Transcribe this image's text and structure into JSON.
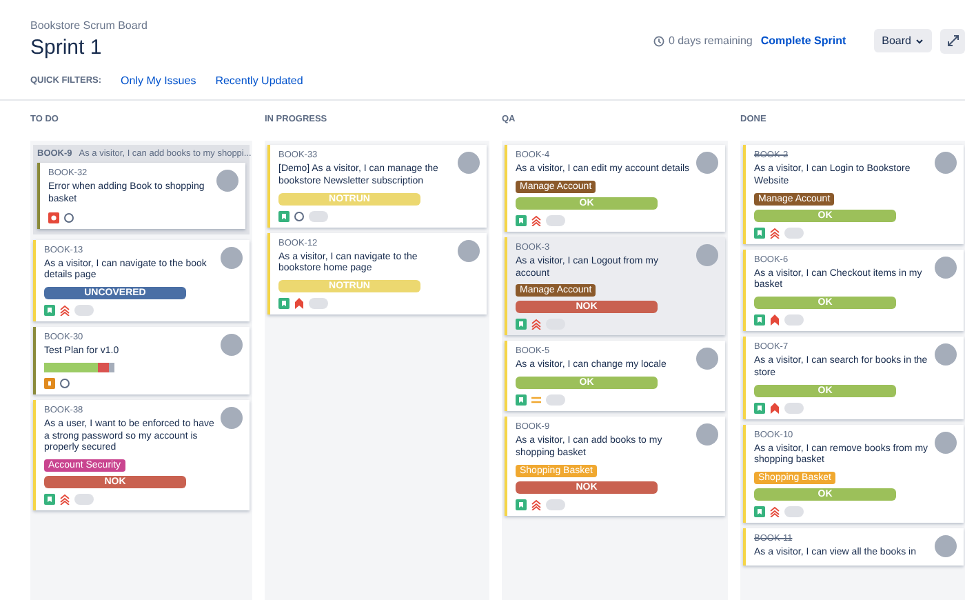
{
  "header": {
    "board_name": "Bookstore Scrum Board",
    "title": "Sprint 1",
    "remaining": "0 days remaining",
    "complete_button": "Complete Sprint",
    "board_button": "Board"
  },
  "quick_filters": {
    "label": "QUICK FILTERS:",
    "filters": [
      {
        "label": "Only My Issues",
        "selected": false
      },
      {
        "label": "Recently Updated",
        "selected": false
      }
    ]
  },
  "columns": [
    {
      "title": "TO DO",
      "groups": [
        {
          "parent_key": "BOOK-9",
          "parent_summary": "As a visitor, I can add books to my shoppi...",
          "cards": [
            {
              "key": "BOOK-32",
              "summary": "Error when adding Book to shopping basket",
              "done": false,
              "selected": false,
              "color": "#8a8a3a",
              "kind": "bug",
              "priority": {
                "kind": "none"
              },
              "avatar": true
            }
          ]
        }
      ],
      "cards": [
        {
          "key": "BOOK-13",
          "summary": "As a visitor, I can navigate to the book details page",
          "done": false,
          "selected": false,
          "color": "#f5d547",
          "kind": "story",
          "priority": {
            "kind": "high"
          },
          "avatar": true,
          "status": {
            "kind": "result",
            "text": "UNCOVERED",
            "color": "#4a6fa5"
          }
        },
        {
          "key": "BOOK-30",
          "summary": "Test Plan for v1.0",
          "done": false,
          "selected": false,
          "color": "#8a8a3a",
          "kind": "plan",
          "priority": {
            "kind": "none"
          },
          "avatar": true,
          "status": {
            "kind": "progress"
          }
        },
        {
          "key": "BOOK-38",
          "summary": "As a user, I want to be enforced to have a strong password so my account is properly secured",
          "done": false,
          "selected": false,
          "color": "#f5d547",
          "kind": "story",
          "priority": {
            "kind": "high"
          },
          "avatar": true,
          "label": {
            "text": "Account Security",
            "color": "#c9448f"
          },
          "status": {
            "kind": "result",
            "text": "NOK",
            "color": "#c96150"
          }
        }
      ]
    },
    {
      "title": "IN PROGRESS",
      "cards": [
        {
          "key": "BOOK-33",
          "summary": "[Demo] As a visitor, I can manage the bookstore Newsletter subscription",
          "done": false,
          "selected": false,
          "color": "#f5d547",
          "kind": "story",
          "priority": {
            "kind": "none"
          },
          "avatar": true,
          "status": {
            "kind": "result",
            "text": "NOTRUN",
            "color": "#ecd870"
          }
        },
        {
          "key": "BOOK-12",
          "summary": "As a visitor, I can navigate to the bookstore home page",
          "done": false,
          "selected": false,
          "color": "#f5d547",
          "kind": "story",
          "priority": {
            "kind": "highest"
          },
          "avatar": true,
          "status": {
            "kind": "result",
            "text": "NOTRUN",
            "color": "#ecd870"
          }
        }
      ]
    },
    {
      "title": "QA",
      "cards": [
        {
          "key": "BOOK-4",
          "summary": "As a visitor, I can edit my account details",
          "done": false,
          "selected": false,
          "color": "#f5d547",
          "kind": "story",
          "priority": {
            "kind": "high"
          },
          "avatar": true,
          "label": {
            "text": "Manage Account",
            "color": "#8b5a2b"
          },
          "status": {
            "kind": "result",
            "text": "OK",
            "color": "#9cc05a"
          }
        },
        {
          "key": "BOOK-3",
          "summary": "As a visitor, I can Logout from my account",
          "done": false,
          "selected": true,
          "color": "#f5d547",
          "kind": "story",
          "priority": {
            "kind": "high"
          },
          "avatar": true,
          "label": {
            "text": "Manage Account",
            "color": "#8b5a2b"
          },
          "status": {
            "kind": "result",
            "text": "NOK",
            "color": "#c96150"
          }
        },
        {
          "key": "BOOK-5",
          "summary": "As a visitor, I can change my locale",
          "done": false,
          "selected": false,
          "color": "#f5d547",
          "kind": "story",
          "priority": {
            "kind": "medium"
          },
          "avatar": true,
          "status": {
            "kind": "result",
            "text": "OK",
            "color": "#9cc05a"
          }
        },
        {
          "key": "BOOK-9",
          "summary": "As a visitor, I can add books to my shopping basket",
          "done": false,
          "selected": false,
          "color": "#f5d547",
          "kind": "story",
          "priority": {
            "kind": "high"
          },
          "avatar": true,
          "label": {
            "text": "Shopping Basket",
            "color": "#f0a830"
          },
          "status": {
            "kind": "result",
            "text": "NOK",
            "color": "#c96150"
          }
        }
      ]
    },
    {
      "title": "DONE",
      "cards": [
        {
          "key": "BOOK-2",
          "summary": "As a visitor, I can Login to Bookstore Website",
          "done": true,
          "selected": false,
          "color": "#f5d547",
          "kind": "story",
          "priority": {
            "kind": "high"
          },
          "avatar": true,
          "label": {
            "text": "Manage Account",
            "color": "#8b5a2b"
          },
          "status": {
            "kind": "result",
            "text": "OK",
            "color": "#9cc05a"
          }
        },
        {
          "key": "BOOK-6",
          "summary": "As a visitor, I can Checkout items in my basket",
          "done": false,
          "selected": false,
          "color": "#f5d547",
          "kind": "story",
          "priority": {
            "kind": "highest"
          },
          "avatar": true,
          "status": {
            "kind": "result",
            "text": "OK",
            "color": "#9cc05a"
          }
        },
        {
          "key": "BOOK-7",
          "summary": "As a visitor, I can search for books in the store",
          "done": false,
          "selected": false,
          "color": "#f5d547",
          "kind": "story",
          "priority": {
            "kind": "highest"
          },
          "avatar": true,
          "status": {
            "kind": "result",
            "text": "OK",
            "color": "#9cc05a"
          }
        },
        {
          "key": "BOOK-10",
          "summary": "As a visitor, I can remove books from my shopping basket",
          "done": false,
          "selected": false,
          "color": "#f5d547",
          "kind": "story",
          "priority": {
            "kind": "high"
          },
          "avatar": true,
          "label": {
            "text": "Shopping Basket",
            "color": "#f0a830"
          },
          "status": {
            "kind": "result",
            "text": "OK",
            "color": "#9cc05a"
          }
        },
        {
          "key": "BOOK-11",
          "summary": "As a visitor, I can view all the books in",
          "done": true,
          "selected": false,
          "color": "#f5d547",
          "avatar": true
        }
      ]
    }
  ]
}
